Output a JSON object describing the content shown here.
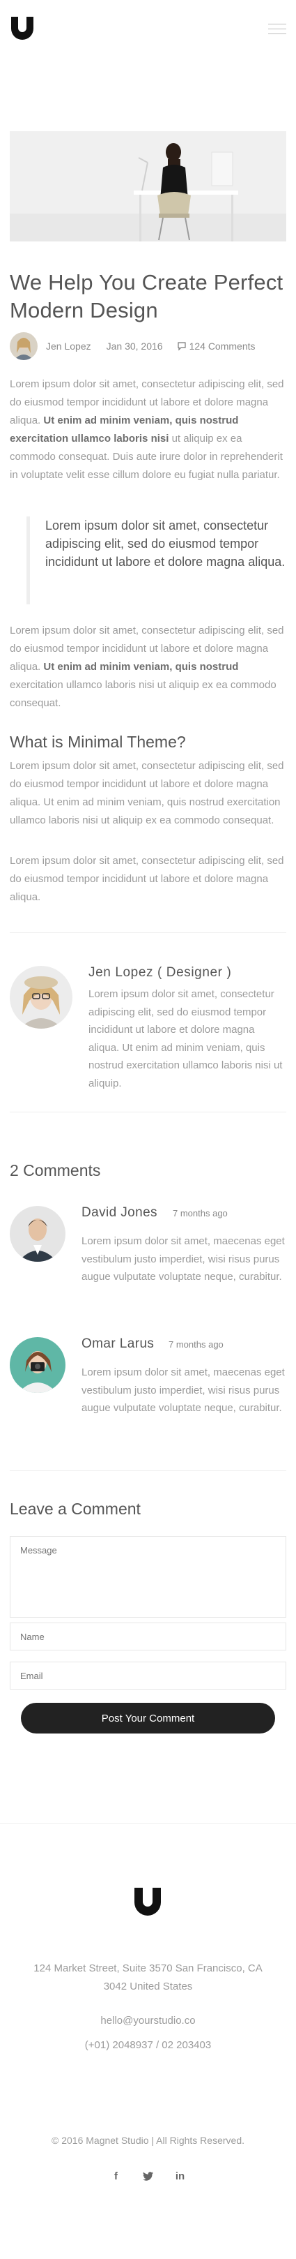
{
  "post": {
    "title": "We Help You Create Perfect Modern Design",
    "author": "Jen Lopez",
    "date": "Jan 30, 2016",
    "comments_count": "124 Comments"
  },
  "content": {
    "p1_a": "Lorem ipsum dolor sit amet, consectetur adipiscing elit, sed do eiusmod tempor incididunt ut labore et dolore magna aliqua. ",
    "p1_bold": "Ut enim ad minim veniam, quis nostrud exercitation ullamco laboris nisi",
    "p1_b": " ut aliquip ex ea commodo consequat. Duis aute irure dolor in reprehenderit in voluptate velit esse cillum dolore eu fugiat nulla pariatur.",
    "quote": "Lorem ipsum dolor sit amet, consectetur adipiscing elit, sed do eiusmod tempor incididunt ut labore et dolore magna aliqua.",
    "p2_a": "Lorem ipsum dolor sit amet, consectetur adipiscing elit, sed do eiusmod tempor incididunt ut labore et dolore magna aliqua. ",
    "p2_bold": "Ut enim ad minim veniam, quis nostrud",
    "p2_b": " exercitation ullamco laboris nisi ut aliquip ex ea commodo consequat.",
    "subheading": "What is Minimal Theme?",
    "p3": "Lorem ipsum dolor sit amet, consectetur adipiscing elit, sed do eiusmod tempor incididunt ut labore et dolore magna aliqua. Ut enim ad minim veniam, quis nostrud exercitation ullamco laboris nisi ut aliquip ex ea commodo consequat.",
    "p4": "Lorem ipsum dolor sit amet, consectetur adipiscing elit, sed do eiusmod tempor incididunt ut labore et dolore magna aliqua."
  },
  "author_box": {
    "name": "Jen Lopez ( Designer )",
    "bio": "Lorem ipsum dolor sit amet, consectetur adipiscing elit, sed do eiusmod tempor incididunt ut labore et dolore magna aliqua. Ut enim ad minim veniam, quis nostrud exercitation ullamco laboris nisi ut aliquip."
  },
  "comments": {
    "heading": "2 Comments",
    "items": [
      {
        "name": "David Jones",
        "time": "7 months ago",
        "text": "Lorem ipsum dolor sit amet, maecenas eget vestibulum justo imperdiet, wisi risus purus augue vulputate voluptate neque, curabitur."
      },
      {
        "name": "Omar Larus",
        "time": "7 months ago",
        "text": "Lorem ipsum dolor sit amet, maecenas eget vestibulum justo imperdiet, wisi risus purus augue vulputate voluptate neque, curabitur."
      }
    ]
  },
  "form": {
    "heading": "Leave a Comment",
    "message_placeholder": "Message",
    "name_placeholder": "Name",
    "email_placeholder": "Email",
    "submit_label": "Post Your Comment"
  },
  "footer": {
    "address": "124 Market Street, Suite 3570 San Francisco, CA 3042 United States",
    "email": "hello@yourstudio.co",
    "phone": "(+01) 2048937 / 02 203403",
    "copyright": "© 2016 Magnet Studio | All Rights Reserved.",
    "socials": [
      "f",
      "t",
      "in"
    ]
  },
  "colors": {
    "text_dark": "#555555",
    "text_body": "#9b9b9b",
    "button": "#222222"
  },
  "icons": [
    "logo-icon",
    "menu-icon",
    "comment-icon",
    "facebook-icon",
    "twitter-icon",
    "linkedin-icon"
  ]
}
